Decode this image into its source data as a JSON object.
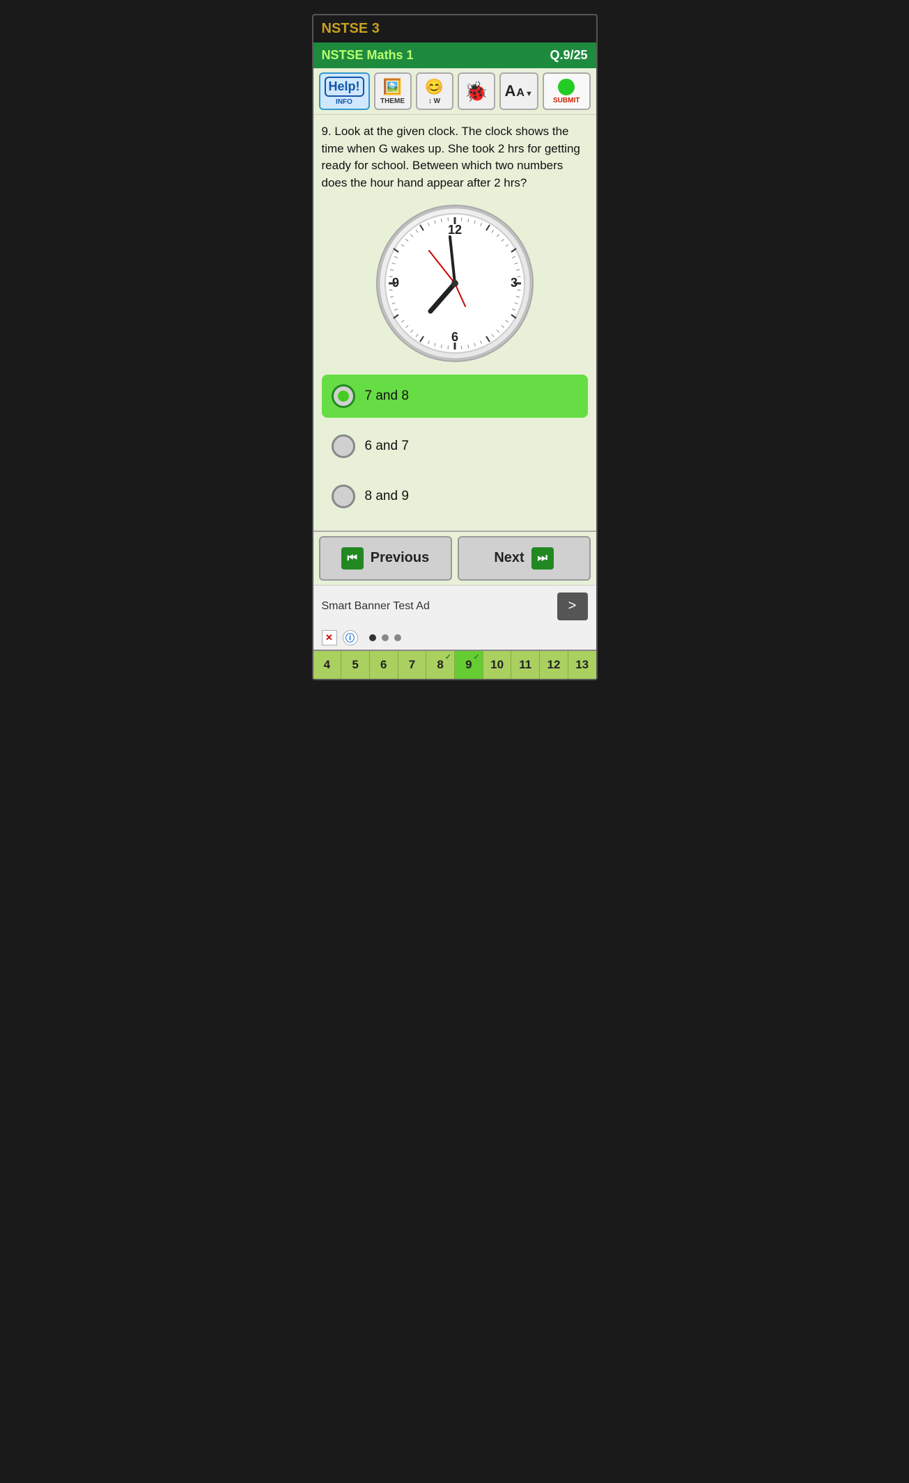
{
  "app": {
    "title": "NSTSE 3",
    "subtitle": "NSTSE Maths 1",
    "question_number": "Q.9/25"
  },
  "toolbar": {
    "info_label": "INFO",
    "theme_label": "THEME",
    "word_label": "W",
    "bug_label": "",
    "font_label": "",
    "submit_label": "SUBMIT"
  },
  "question": {
    "number": "9.",
    "text": "9. Look at the given clock. The clock shows the time when G wakes up. She took 2 hrs for getting ready for school. Between which two numbers does the hour hand appear after 2 hrs?"
  },
  "options": [
    {
      "id": "A",
      "label": "7 and 8",
      "selected": true
    },
    {
      "id": "B",
      "label": "6 and 7",
      "selected": false
    },
    {
      "id": "C",
      "label": "8 and 9",
      "selected": false
    }
  ],
  "navigation": {
    "previous_label": "Previous",
    "next_label": "Next"
  },
  "banner": {
    "text": "Smart Banner Test Ad"
  },
  "question_numbers": [
    {
      "num": "4",
      "current": false,
      "answered": false
    },
    {
      "num": "5",
      "current": false,
      "answered": false
    },
    {
      "num": "6",
      "current": false,
      "answered": false
    },
    {
      "num": "7",
      "current": false,
      "answered": false
    },
    {
      "num": "8",
      "current": false,
      "answered": true
    },
    {
      "num": "9",
      "current": true,
      "answered": true
    },
    {
      "num": "10",
      "current": false,
      "answered": false
    },
    {
      "num": "11",
      "current": false,
      "answered": false
    },
    {
      "num": "12",
      "current": false,
      "answered": false
    },
    {
      "num": "13",
      "current": false,
      "answered": false
    }
  ]
}
